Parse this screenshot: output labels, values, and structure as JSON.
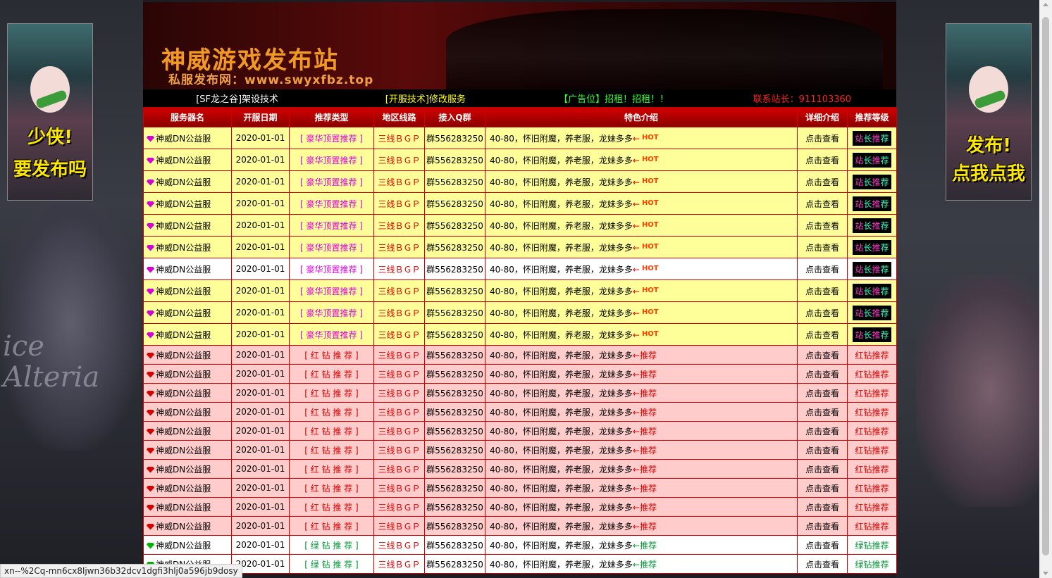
{
  "banner": {
    "title": "神威游戏发布站",
    "subtitle": "私服发布网：www.swyxfbz.top"
  },
  "side_ads": {
    "left_line1": "少侠!",
    "left_line2": "要发布吗",
    "right_line1": "发布!",
    "right_line2": "点我点我"
  },
  "background_text": {
    "line1": "ice",
    "line2": "Alteria"
  },
  "topbar": {
    "item1": "[SF龙之谷]架设技术",
    "item2": "[开服技术]修改服务",
    "item3": "【广告位】招租！招租！！",
    "item4": "联系站长：911103360",
    "colors": {
      "item1": "#ffffff",
      "item2": "#ffff00",
      "item3": "#33ff33",
      "item4": "#ff2222"
    }
  },
  "columns": [
    "服务器名",
    "开服日期",
    "推荐类型",
    "地区线路",
    "接入Q群",
    "特色介绍",
    "详细介绍",
    "推荐等级"
  ],
  "rows": [
    {
      "style": "yel",
      "gem": "purple",
      "name": "神威DN公益服",
      "date": "2020-01-01",
      "type": "[ 豪华顶置推荐 ]",
      "type_class": "pinktxt",
      "line": "三线ＢＧＰ",
      "qq": "群556283250",
      "feat": "40-80，怀旧附魔，养老服，龙妹多多",
      "arrow": "←",
      "tag": "HOT",
      "detail": "点击查看",
      "level": "站长推荐"
    },
    {
      "style": "yel",
      "gem": "purple",
      "name": "神威DN公益服",
      "date": "2020-01-01",
      "type": "[ 豪华顶置推荐 ]",
      "type_class": "pinktxt",
      "line": "三线ＢＧＰ",
      "qq": "群556283250",
      "feat": "40-80，怀旧附魔，养老服，龙妹多多",
      "arrow": "←",
      "tag": "HOT",
      "detail": "点击查看",
      "level": "站长推荐"
    },
    {
      "style": "yel",
      "gem": "purple",
      "name": "神威DN公益服",
      "date": "2020-01-01",
      "type": "[ 豪华顶置推荐 ]",
      "type_class": "pinktxt",
      "line": "三线ＢＧＰ",
      "qq": "群556283250",
      "feat": "40-80，怀旧附魔，养老服，龙妹多多",
      "arrow": "←",
      "tag": "HOT",
      "detail": "点击查看",
      "level": "站长推荐"
    },
    {
      "style": "yel",
      "gem": "purple",
      "name": "神威DN公益服",
      "date": "2020-01-01",
      "type": "[ 豪华顶置推荐 ]",
      "type_class": "pinktxt",
      "line": "三线ＢＧＰ",
      "qq": "群556283250",
      "feat": "40-80，怀旧附魔，养老服，龙妹多多",
      "arrow": "←",
      "tag": "HOT",
      "detail": "点击查看",
      "level": "站长推荐"
    },
    {
      "style": "yel",
      "gem": "purple",
      "name": "神威DN公益服",
      "date": "2020-01-01",
      "type": "[ 豪华顶置推荐 ]",
      "type_class": "pinktxt",
      "line": "三线ＢＧＰ",
      "qq": "群556283250",
      "feat": "40-80，怀旧附魔，养老服，龙妹多多",
      "arrow": "←",
      "tag": "HOT",
      "detail": "点击查看",
      "level": "站长推荐"
    },
    {
      "style": "yel",
      "gem": "purple",
      "name": "神威DN公益服",
      "date": "2020-01-01",
      "type": "[ 豪华顶置推荐 ]",
      "type_class": "pinktxt",
      "line": "三线ＢＧＰ",
      "qq": "群556283250",
      "feat": "40-80，怀旧附魔，养老服，龙妹多多",
      "arrow": "←",
      "tag": "HOT",
      "detail": "点击查看",
      "level": "站长推荐"
    },
    {
      "style": "wht",
      "gem": "purple",
      "name": "神威DN公益服",
      "date": "2020-01-01",
      "type": "[ 豪华顶置推荐 ]",
      "type_class": "pinktxt",
      "line": "三线ＢＧＰ",
      "qq": "群556283250",
      "feat": "40-80，怀旧附魔，养老服，龙妹多多",
      "arrow": "←",
      "tag": "HOT",
      "detail": "点击查看",
      "level": "站长推荐"
    },
    {
      "style": "yel",
      "gem": "purple",
      "name": "神威DN公益服",
      "date": "2020-01-01",
      "type": "[ 豪华顶置推荐 ]",
      "type_class": "pinktxt",
      "line": "三线ＢＧＰ",
      "qq": "群556283250",
      "feat": "40-80，怀旧附魔，养老服，龙妹多多",
      "arrow": "←",
      "tag": "HOT",
      "detail": "点击查看",
      "level": "站长推荐"
    },
    {
      "style": "yel",
      "gem": "purple",
      "name": "神威DN公益服",
      "date": "2020-01-01",
      "type": "[ 豪华顶置推荐 ]",
      "type_class": "pinktxt",
      "line": "三线ＢＧＰ",
      "qq": "群556283250",
      "feat": "40-80，怀旧附魔，养老服，龙妹多多",
      "arrow": "←",
      "tag": "HOT",
      "detail": "点击查看",
      "level": "站长推荐"
    },
    {
      "style": "yel",
      "gem": "purple",
      "name": "神威DN公益服",
      "date": "2020-01-01",
      "type": "[ 豪华顶置推荐 ]",
      "type_class": "pinktxt",
      "line": "三线ＢＧＰ",
      "qq": "群556283250",
      "feat": "40-80，怀旧附魔，养老服，龙妹多多",
      "arrow": "←",
      "tag": "HOT",
      "detail": "点击查看",
      "level": "站长推荐"
    },
    {
      "style": "pink",
      "gem": "red",
      "name": "神威DN公益服",
      "date": "2020-01-01",
      "type": "[ 红 钻 推 荐 ]",
      "type_class": "redtxt",
      "line": "三线ＢＧＰ",
      "qq": "群556283250",
      "feat": "40-80，怀旧附魔，养老服，龙妹多多",
      "arrow": "←",
      "tag": "推荐",
      "detail": "点击查看",
      "level": "红钻推荐"
    },
    {
      "style": "pink",
      "gem": "red",
      "name": "神威DN公益服",
      "date": "2020-01-01",
      "type": "[ 红 钻 推 荐 ]",
      "type_class": "redtxt",
      "line": "三线ＢＧＰ",
      "qq": "群556283250",
      "feat": "40-80，怀旧附魔，养老服，龙妹多多",
      "arrow": "←",
      "tag": "推荐",
      "detail": "点击查看",
      "level": "红钻推荐"
    },
    {
      "style": "pink",
      "gem": "red",
      "name": "神威DN公益服",
      "date": "2020-01-01",
      "type": "[ 红 钻 推 荐 ]",
      "type_class": "redtxt",
      "line": "三线ＢＧＰ",
      "qq": "群556283250",
      "feat": "40-80，怀旧附魔，养老服，龙妹多多",
      "arrow": "←",
      "tag": "推荐",
      "detail": "点击查看",
      "level": "红钻推荐"
    },
    {
      "style": "pink",
      "gem": "red",
      "name": "神威DN公益服",
      "date": "2020-01-01",
      "type": "[ 红 钻 推 荐 ]",
      "type_class": "redtxt",
      "line": "三线ＢＧＰ",
      "qq": "群556283250",
      "feat": "40-80，怀旧附魔，养老服，龙妹多多",
      "arrow": "←",
      "tag": "推荐",
      "detail": "点击查看",
      "level": "红钻推荐"
    },
    {
      "style": "pink",
      "gem": "red",
      "name": "神威DN公益服",
      "date": "2020-01-01",
      "type": "[ 红 钻 推 荐 ]",
      "type_class": "redtxt",
      "line": "三线ＢＧＰ",
      "qq": "群556283250",
      "feat": "40-80，怀旧附魔，养老服，龙妹多多",
      "arrow": "←",
      "tag": "推荐",
      "detail": "点击查看",
      "level": "红钻推荐"
    },
    {
      "style": "pink",
      "gem": "red",
      "name": "神威DN公益服",
      "date": "2020-01-01",
      "type": "[ 红 钻 推 荐 ]",
      "type_class": "redtxt",
      "line": "三线ＢＧＰ",
      "qq": "群556283250",
      "feat": "40-80，怀旧附魔，养老服，龙妹多多",
      "arrow": "←",
      "tag": "推荐",
      "detail": "点击查看",
      "level": "红钻推荐"
    },
    {
      "style": "pink",
      "gem": "red",
      "name": "神威DN公益服",
      "date": "2020-01-01",
      "type": "[ 红 钻 推 荐 ]",
      "type_class": "redtxt",
      "line": "三线ＢＧＰ",
      "qq": "群556283250",
      "feat": "40-80，怀旧附魔，养老服，龙妹多多",
      "arrow": "←",
      "tag": "推荐",
      "detail": "点击查看",
      "level": "红钻推荐"
    },
    {
      "style": "pink",
      "gem": "red",
      "name": "神威DN公益服",
      "date": "2020-01-01",
      "type": "[ 红 钻 推 荐 ]",
      "type_class": "redtxt",
      "line": "三线ＢＧＰ",
      "qq": "群556283250",
      "feat": "40-80，怀旧附魔，养老服，龙妹多多",
      "arrow": "←",
      "tag": "推荐",
      "detail": "点击查看",
      "level": "红钻推荐"
    },
    {
      "style": "pink",
      "gem": "red",
      "name": "神威DN公益服",
      "date": "2020-01-01",
      "type": "[ 红 钻 推 荐 ]",
      "type_class": "redtxt",
      "line": "三线ＢＧＰ",
      "qq": "群556283250",
      "feat": "40-80，怀旧附魔，养老服，龙妹多多",
      "arrow": "←",
      "tag": "推荐",
      "detail": "点击查看",
      "level": "红钻推荐"
    },
    {
      "style": "pink",
      "gem": "red",
      "name": "神威DN公益服",
      "date": "2020-01-01",
      "type": "[ 红 钻 推 荐 ]",
      "type_class": "redtxt",
      "line": "三线ＢＧＰ",
      "qq": "群556283250",
      "feat": "40-80，怀旧附魔，养老服，龙妹多多",
      "arrow": "←",
      "tag": "推荐",
      "detail": "点击查看",
      "level": "红钻推荐"
    },
    {
      "style": "grn",
      "gem": "green",
      "name": "神威DN公益服",
      "date": "2020-01-01",
      "type": "[ 绿 钻 推 荐 ]",
      "type_class": "grntxt",
      "line": "三线ＢＧＰ",
      "qq": "群556283250",
      "feat": "40-80，怀旧附魔，养老服，龙妹多多",
      "arrow": "←",
      "tag": "推荐",
      "detail": "点击查看",
      "level": "绿钻推荐"
    },
    {
      "style": "grn",
      "gem": "green",
      "name": "神威DN公益服",
      "date": "2020-01-01",
      "type": "[ 绿 钻 推 荐 ]",
      "type_class": "grntxt",
      "line": "三线ＢＧＰ",
      "qq": "群556283250",
      "feat": "40-80，怀旧附魔，养老服，龙妹多多",
      "arrow": "←",
      "tag": "推荐",
      "detail": "点击查看",
      "level": "绿钻推荐"
    }
  ],
  "status_url": "xn--%2Cq-mn6cx8ljwn36b32dcv1dgfi3hlj0a596jb9dosy"
}
